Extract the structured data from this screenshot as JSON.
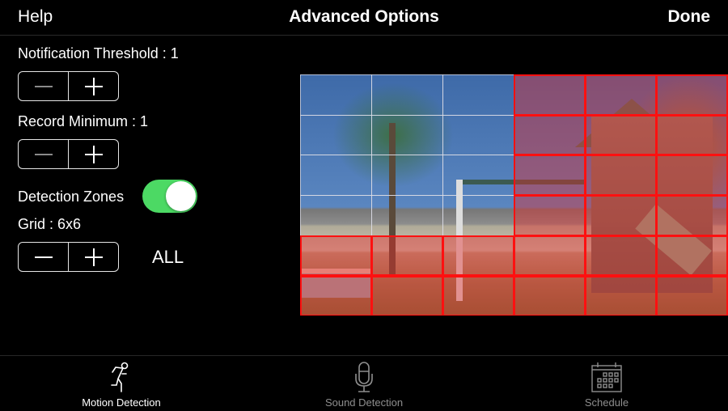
{
  "navbar": {
    "left_label": "Help",
    "title": "Advanced Options",
    "right_label": "Done"
  },
  "settings": {
    "notification_threshold": {
      "label": "Notification Threshold : 1",
      "value": 1
    },
    "record_minimum": {
      "label": "Record Minimum : 1",
      "value": 1
    },
    "detection_zones": {
      "label": "Detection Zones",
      "enabled": true,
      "toggle_color": "#4cd964"
    },
    "grid": {
      "label": "Grid : 6x6",
      "columns": 6,
      "rows": 6,
      "all_label": "ALL"
    },
    "stepper": {
      "minus_icon": "minus-icon",
      "plus_icon": "plus-icon"
    }
  },
  "zones": {
    "selected_color": "#ff1010",
    "selected": [
      [
        false,
        false,
        false,
        true,
        true,
        true
      ],
      [
        false,
        false,
        false,
        true,
        true,
        true
      ],
      [
        false,
        false,
        false,
        true,
        true,
        true
      ],
      [
        false,
        false,
        false,
        true,
        true,
        true
      ],
      [
        true,
        true,
        true,
        true,
        true,
        true
      ],
      [
        true,
        true,
        true,
        true,
        true,
        true
      ]
    ]
  },
  "tabbar": {
    "tabs": [
      {
        "label": "Motion Detection",
        "icon": "running-person-icon",
        "active": true
      },
      {
        "label": "Sound Detection",
        "icon": "microphone-icon",
        "active": false
      },
      {
        "label": "Schedule",
        "icon": "calendar-icon",
        "active": false
      }
    ]
  }
}
